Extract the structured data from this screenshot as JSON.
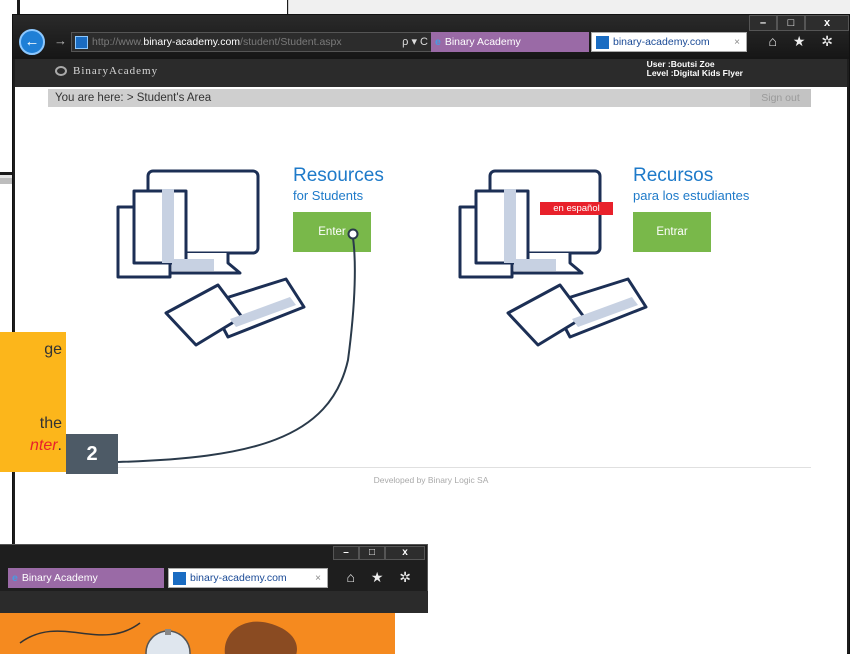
{
  "browser": {
    "window_controls": {
      "minimize": "–",
      "maximize": "□",
      "close": "x"
    },
    "back_icon": "back-arrow-icon",
    "forward_icon": "forward-arrow-icon",
    "address": {
      "prefix": "http://www.",
      "domain": "binary-academy.com",
      "path": "/student/Student.aspx",
      "controls": "ρ ▾ C"
    },
    "tabs": [
      {
        "label": "Binary Academy"
      },
      {
        "label": "binary-academy.com",
        "close": "×"
      }
    ],
    "toolbar_icons": "⌂ ★ ✲"
  },
  "site": {
    "logo_text": "BinaryAcademy",
    "user_line": "User :Boutsi Zoe",
    "level_line": "Level :Digital Kids Flyer"
  },
  "breadcrumb": {
    "text": "You are here:  > Student's Area",
    "signout": "Sign out"
  },
  "cards": [
    {
      "title": "Resources",
      "subtitle": "for Students",
      "button": "Enter"
    },
    {
      "title": "Recursos",
      "subtitle": "para los estudiantes",
      "button": "Entrar",
      "badge": "en español"
    }
  ],
  "footer": "Developed by Binary Logic SA",
  "callout": {
    "line1": "ge",
    "line2": "the",
    "line3_red": "nter",
    "line3_tail": ".",
    "step": "2"
  },
  "browser2": {
    "tabs": [
      {
        "label": "Binary Academy"
      },
      {
        "label": "binary-academy.com",
        "close": "×"
      }
    ],
    "toolbar_icons": "⌂ ★ ✲",
    "window_controls": {
      "minimize": "–",
      "maximize": "□",
      "close": "x"
    }
  },
  "colors": {
    "accent_blue": "#1e7ac9",
    "button_green": "#79b84a",
    "badge_red": "#e8212b",
    "callout_orange": "#fcb61b"
  }
}
